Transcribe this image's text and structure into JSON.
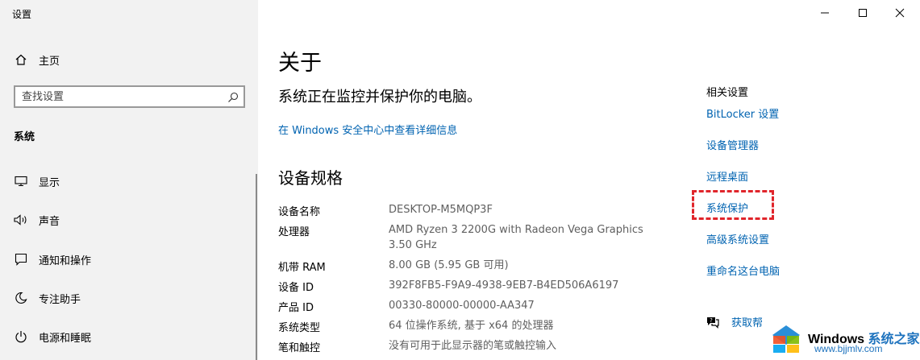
{
  "window": {
    "title": "设置",
    "controls": {
      "minimize": "minimize-icon",
      "maximize": "maximize-icon",
      "close": "close-icon"
    }
  },
  "sidebar": {
    "home_label": "主页",
    "search": {
      "placeholder": "查找设置",
      "value": ""
    },
    "section_title": "系统",
    "items": [
      {
        "label": "显示",
        "icon": "display-icon"
      },
      {
        "label": "声音",
        "icon": "sound-icon"
      },
      {
        "label": "通知和操作",
        "icon": "notification-icon"
      },
      {
        "label": "专注助手",
        "icon": "focus-assist-icon"
      },
      {
        "label": "电源和睡眠",
        "icon": "power-icon"
      }
    ]
  },
  "main": {
    "title": "关于",
    "protect_text": "系统正在监控并保护你的电脑。",
    "security_link": "在 Windows 安全中心中查看详细信息",
    "spec_title": "设备规格",
    "specs": [
      {
        "label": "设备名称",
        "value": "DESKTOP-M5MQP3F"
      },
      {
        "label": "处理器",
        "value": "AMD Ryzen 3 2200G with Radeon Vega Graphics",
        "value2": "3.50 GHz"
      },
      {
        "label": "机带 RAM",
        "value": "8.00 GB (5.95 GB 可用)"
      },
      {
        "label": "设备 ID",
        "value": "392F8FB5-F9A9-4938-9EB7-B4ED506A6197"
      },
      {
        "label": "产品 ID",
        "value": "00330-80000-00000-AA347"
      },
      {
        "label": "系统类型",
        "value": "64 位操作系统, 基于 x64 的处理器"
      },
      {
        "label": "笔和触控",
        "value": "没有可用于此显示器的笔或触控输入"
      }
    ]
  },
  "related": {
    "title": "相关设置",
    "links": [
      "BitLocker 设置",
      "设备管理器",
      "远程桌面",
      "系统保护",
      "高级系统设置",
      "重命名这台电脑"
    ],
    "highlighted": "系统保护",
    "highlight_color": "#e0252b",
    "help_label": "获取帮"
  },
  "watermark": {
    "brand": "Windows",
    "brand_suffix": "系统之家",
    "url": "www.bjjmlv.com"
  },
  "colors": {
    "link": "#0063b1",
    "sidebar_bg": "#f2f2f2"
  }
}
